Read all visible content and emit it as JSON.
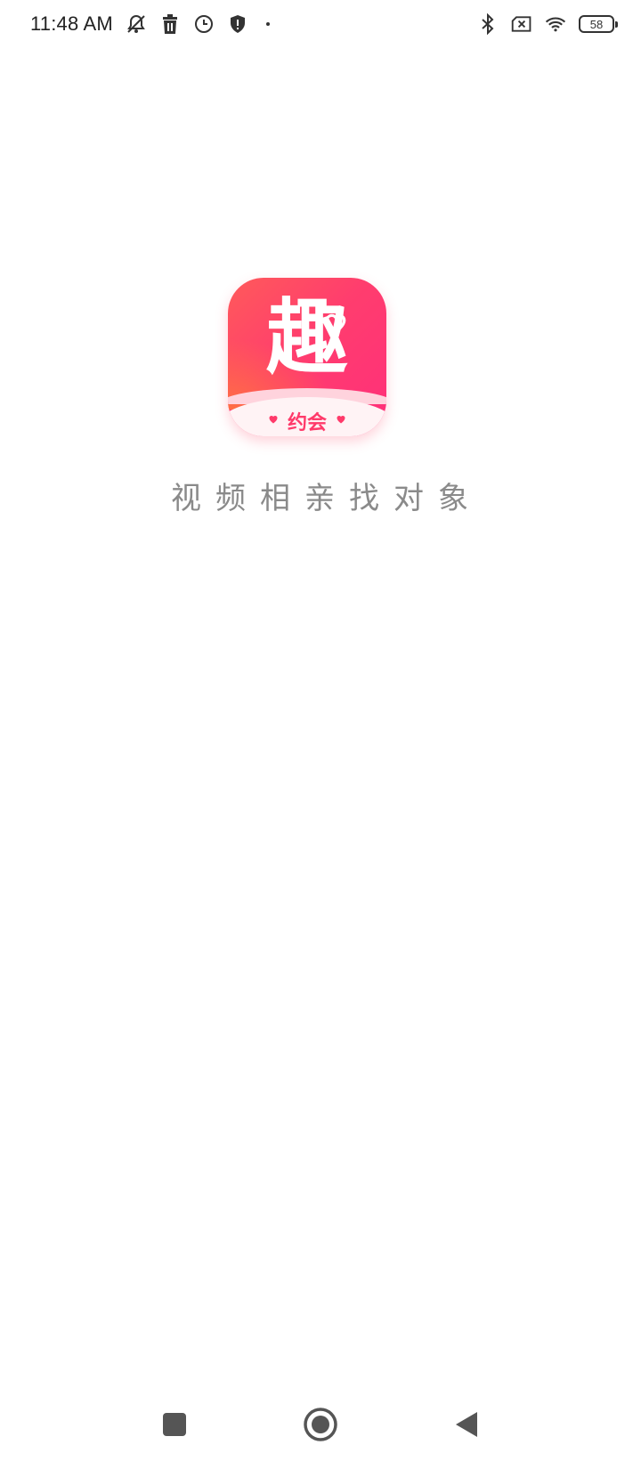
{
  "status_bar": {
    "time": "11:48 AM",
    "battery_level": "58",
    "icons_left": [
      "notifications-off-icon",
      "trash-icon",
      "clock-icon",
      "shield-icon",
      "dot-icon"
    ],
    "icons_right": [
      "bluetooth-icon",
      "sim-x-icon",
      "wifi-icon",
      "battery-icon"
    ]
  },
  "splash": {
    "logo_char": "趣",
    "logo_badge": "约会",
    "tagline": "视频相亲找对象",
    "colors": {
      "logo_gradient_start": "#ff5a5a",
      "logo_gradient_end": "#ff2f7a",
      "badge_text": "#ff3a6a",
      "tagline_text": "#8a8a8a"
    }
  },
  "nav_bar": {
    "buttons": [
      "recents-square-icon",
      "home-circle-icon",
      "back-triangle-icon"
    ]
  }
}
